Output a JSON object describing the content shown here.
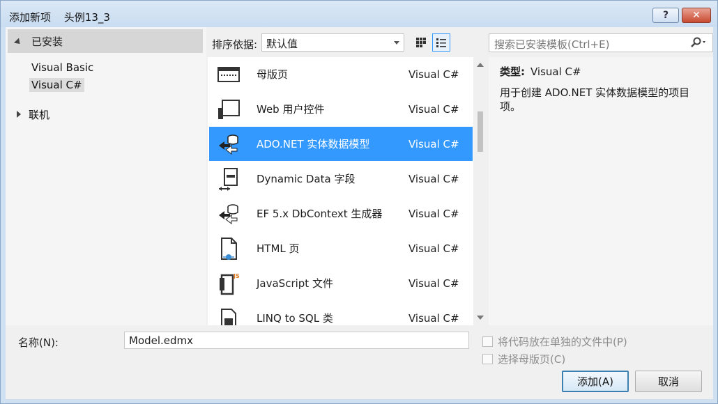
{
  "window": {
    "title": "添加新项",
    "project": "头例13_3",
    "help_label": "?",
    "close_label": "✕"
  },
  "tree": {
    "header": "已安装",
    "items": [
      "Visual Basic",
      "Visual C#"
    ],
    "online": "联机"
  },
  "toolbar": {
    "sort_label": "排序依据:",
    "sort_value": "默认值",
    "search_placeholder": "搜索已安装模板(Ctrl+E)"
  },
  "templates": [
    {
      "name": "母版页",
      "lang": "Visual C#",
      "icon": "master-page-icon"
    },
    {
      "name": "Web 用户控件",
      "lang": "Visual C#",
      "icon": "web-user-control-icon"
    },
    {
      "name": "ADO.NET 实体数据模型",
      "lang": "Visual C#",
      "icon": "entity-model-icon"
    },
    {
      "name": "Dynamic Data 字段",
      "lang": "Visual C#",
      "icon": "dynamic-data-icon"
    },
    {
      "name": "EF 5.x DbContext 生成器",
      "lang": "Visual C#",
      "icon": "dbcontext-icon"
    },
    {
      "name": "HTML 页",
      "lang": "Visual C#",
      "icon": "html-page-icon"
    },
    {
      "name": "JavaScript 文件",
      "lang": "Visual C#",
      "icon": "javascript-file-icon"
    },
    {
      "name": "LINQ to SQL 类",
      "lang": "Visual C#",
      "icon": "linq-sql-icon"
    }
  ],
  "info": {
    "type_label": "类型:",
    "type_value": "Visual C#",
    "description": "用于创建 ADO.NET 实体数据模型的项目项。"
  },
  "bottom": {
    "name_label": "名称(N):",
    "name_value": "Model.edmx",
    "check1": "将代码放在单独的文件中(P)",
    "check2": "选择母版页(C)",
    "add_label": "添加(A)",
    "cancel_label": "取消"
  },
  "colors": {
    "selection": "#3399ff",
    "title_bar": "#cfe0f3",
    "close_button": "#c84a31"
  }
}
